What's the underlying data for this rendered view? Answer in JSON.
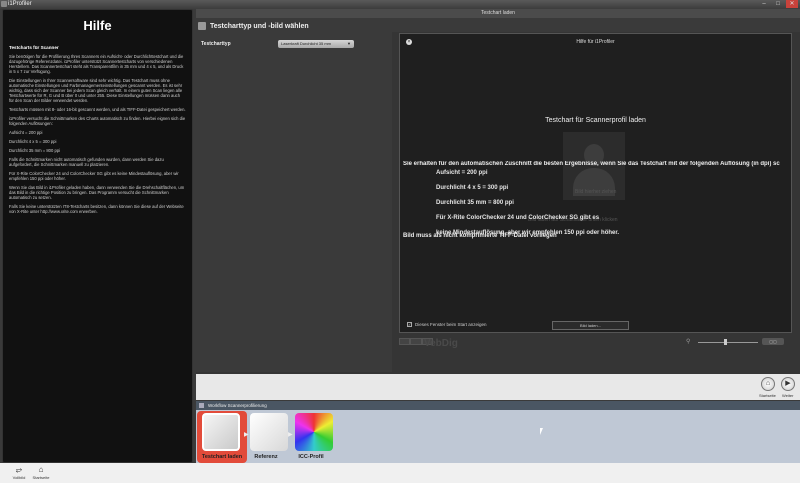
{
  "window": {
    "title": "i1Profiler"
  },
  "help": {
    "title": "Hilfe",
    "heading": "Testcharts für Scanner",
    "paragraphs": [
      "Sie benötigen für die Profilierung Ihres Scanners ein Aufsicht- oder Durchlichttestchart und die dazugehörige Referenzdatei. i1Profiler unterstützt Scannertestcharts von verschiedenen Herstellern. Das Scannertestchart steht als Transparentfilm in 35 mm und 4 x 5, und als Druck in 5 x 7 zur Verfügung.",
      "Die Einstellungen in Ihrer Scannersoftware sind sehr wichtig. Das Testchart muss ohne automatische Einstellungen und Farbmanagementeinstellungen gescannt werden. Es ist sehr wichtig, dass sich der Scanner bei jedem Scan gleich verhält. In einem guten Scan liegen alle Testchartwerte für R, G und B über 0 und unter 255. Diese Einstellungen müssen dann auch für den Scan der Bilder verwendet werden.",
      "Testcharts müssen mit 8- oder 16-bit gescannt werden, und als TIFF-Datei gespeichert werden.",
      "i1Profiler versucht die Schnittmarken des Charts automatisch zu finden. Hierbei eignen sich die folgenden Auflösungen:",
      "Aufsicht = 200 ppi",
      "Durchlicht 4 x 5 = 300 ppi",
      "Durchlicht 35 mm = 800 ppi",
      "Falls die Schnittmarken nicht automatisch gefunden wurden, dann werden Sie dazu aufgefordert, die Schnittmarken manuell zu platzieren.",
      "Für X-Rite ColorChecker 24 und ColorChecker SG gibt es keine Mindestauflösung, aber wir empfehlen 150 ppi oder höher.",
      "Wenn Sie das Bild in i1Profiler geladen haben, dann verwenden Sie die Drehschaltflächen, um das Bild in die richtige Position zu bringen. Das Programm versucht die Schnittmarken automatisch zu setzen.",
      "Falls Sie keine unterstützten IT8-Testcharts besitzen, dann können Sie diese auf der Webseite von X-Rite unter http://www.xrite.com erwerben."
    ]
  },
  "main": {
    "header": "Testchart laden",
    "section_title": "Testcharttyp und -bild wählen",
    "testcharttyp_label": "Testcharttyp",
    "testcharttyp_value": "Laserkraft Durchlicht 35 mm"
  },
  "dialog": {
    "title": "Hilfe für i1Profiler",
    "heading": "Testchart für Scannerprofil laden",
    "lead": "Sie erhalten für den automatischen Zuschnitt die besten Ergebnisse, wenn Sie das Testchart mit der folgenden Auflösung (in dpi) sc",
    "resolutions": [
      "Aufsicht = 200 ppi",
      "Durchlicht 4 x 5 = 300 ppi",
      "Durchlicht 35 mm = 800 ppi",
      "Für X-Rite ColorChecker 24 und ColorChecker SG gibt es",
      "keine Mindestauflösung, aber wir empfehlen 150 ppi oder höher."
    ],
    "footer_note": "Bild muss als nicht komprimierte TIFF-Datei vorliegen",
    "ghost_text_1": "Bild hierher ziehen",
    "ghost_text_2": "Bild laden auf Schaltfläche unten klicken",
    "checkbox_label": "Dieses Fenster beim Start anzeigen",
    "button_label": "Bild laden..."
  },
  "ghost_vebdig": "VebDig",
  "nav": {
    "home_label": "Startseite",
    "next_label": "Weiter"
  },
  "workflow": {
    "title": "Workflow Scannerprofilierung",
    "steps": [
      {
        "label": "Testchart laden"
      },
      {
        "label": "Referenz"
      },
      {
        "label": "ICC-Profil"
      }
    ]
  },
  "bottom_bar": {
    "items": [
      {
        "label": "Vollbild"
      },
      {
        "label": "Startseite"
      }
    ]
  },
  "colors": {
    "accent": "#e24b3a",
    "workflow_bg": "#bfc8d5"
  }
}
